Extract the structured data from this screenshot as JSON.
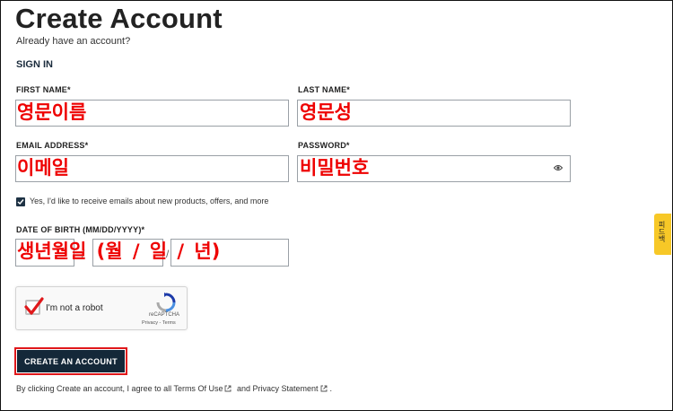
{
  "header": {
    "title": "Create Account",
    "subtitle": "Already have an account?",
    "signin_link": "SIGN IN"
  },
  "form": {
    "first_name": {
      "label": "FIRST NAME*",
      "annotation": "영문이름"
    },
    "last_name": {
      "label": "LAST NAME*",
      "annotation": "영문성"
    },
    "email": {
      "label": "EMAIL ADDRESS*",
      "annotation": "이메일"
    },
    "password": {
      "label": "PASSWORD*",
      "annotation": "비밀번호",
      "toggle_icon": "eye-icon"
    },
    "marketing_opt_in": {
      "checked": true,
      "label": "Yes, I'd like to receive emails about new products, offers, and more"
    },
    "dob": {
      "label": "DATE OF BIRTH (MM/DD/YYYY)*",
      "annotation": "생년월일 (월 / 일 / 년)",
      "separator": "/"
    }
  },
  "recaptcha": {
    "label": "I'm not a robot",
    "checked": true,
    "brand": "reCAPTCHA",
    "terms": "Privacy - Terms"
  },
  "submit": {
    "label": "CREATE AN ACCOUNT",
    "highlight_color": "#e0181b",
    "bg_color": "#142839"
  },
  "legal": {
    "prefix": "By clicking Create an account, I agree to all",
    "terms_link": "Terms Of Use",
    "conjunction": "and",
    "privacy_link": "Privacy Statement",
    "suffix": "."
  },
  "feedback_tab": {
    "label": "피드백",
    "color": "#f7c827"
  },
  "colors": {
    "annotation": "#ee0000",
    "checkbox": "#1e3244"
  }
}
